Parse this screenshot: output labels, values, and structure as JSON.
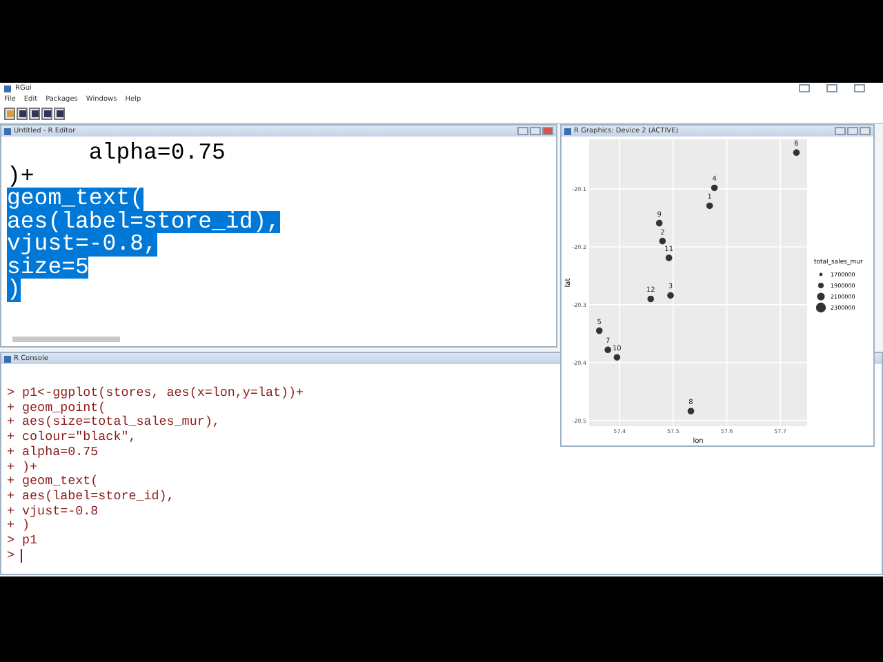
{
  "app": {
    "title": "RGui",
    "menu": [
      "File",
      "Edit",
      "Packages",
      "Windows",
      "Help"
    ]
  },
  "editor": {
    "title": "Untitled - R Editor",
    "lines": [
      {
        "text": "      alpha=0.75",
        "selected": false
      },
      {
        "text": ")+",
        "selected": false
      },
      {
        "text": "geom_text(",
        "selected": true
      },
      {
        "text": "aes(label=store_id),",
        "selected": true
      },
      {
        "text": "vjust=-0.8,",
        "selected": true
      },
      {
        "text": "size=5",
        "selected": true
      },
      {
        "text": ")",
        "selected": true
      }
    ]
  },
  "graphics": {
    "title": "R Graphics: Device 2 (ACTIVE)",
    "legend": {
      "title": "total_sales_mur",
      "items": [
        "1700000",
        "1900000",
        "2100000",
        "2300000"
      ]
    },
    "chart_data": {
      "type": "scatter",
      "grid": true,
      "xlabel": "lon",
      "ylabel": "lat",
      "xlim": [
        57.343,
        57.75
      ],
      "ylim": [
        -20.51,
        -20.014
      ],
      "xticks": [
        57.4,
        57.5,
        57.6,
        57.7
      ],
      "yticks": [
        -20.5,
        -20.4,
        -20.3,
        -20.2,
        -20.1
      ],
      "x": [
        57.73,
        57.577,
        57.568,
        57.474,
        57.48,
        57.492,
        57.495,
        57.458,
        57.362,
        57.378,
        57.395,
        57.533
      ],
      "series": [
        {
          "color": "#333333",
          "values": [
            -20.037,
            -20.098,
            -20.129,
            -20.159,
            -20.19,
            -20.219,
            -20.284,
            -20.29,
            -20.345,
            -20.378,
            -20.391,
            -20.484
          ]
        }
      ],
      "annotations": [
        {
          "text": "6",
          "x": 57.73,
          "y": -20.037
        },
        {
          "text": "4",
          "x": 57.577,
          "y": -20.098
        },
        {
          "text": "1",
          "x": 57.568,
          "y": -20.129
        },
        {
          "text": "9",
          "x": 57.474,
          "y": -20.159
        },
        {
          "text": "2",
          "x": 57.48,
          "y": -20.19
        },
        {
          "text": "11",
          "x": 57.492,
          "y": -20.219
        },
        {
          "text": "3",
          "x": 57.495,
          "y": -20.284
        },
        {
          "text": "12",
          "x": 57.458,
          "y": -20.29
        },
        {
          "text": "5",
          "x": 57.362,
          "y": -20.345
        },
        {
          "text": "7",
          "x": 57.378,
          "y": -20.378
        },
        {
          "text": "10",
          "x": 57.395,
          "y": -20.391
        },
        {
          "text": "8",
          "x": 57.533,
          "y": -20.484
        }
      ]
    }
  },
  "console": {
    "title": "R Console",
    "lines": [
      "> p1<-ggplot(stores, aes(x=lon,y=lat))+",
      "+ geom_point(",
      "+ aes(size=total_sales_mur),",
      "+ colour=\"black\",",
      "+ alpha=0.75",
      "+ )+",
      "+ geom_text(",
      "+ aes(label=store_id),",
      "+ vjust=-0.8",
      "+ )",
      "> p1",
      ">"
    ]
  }
}
